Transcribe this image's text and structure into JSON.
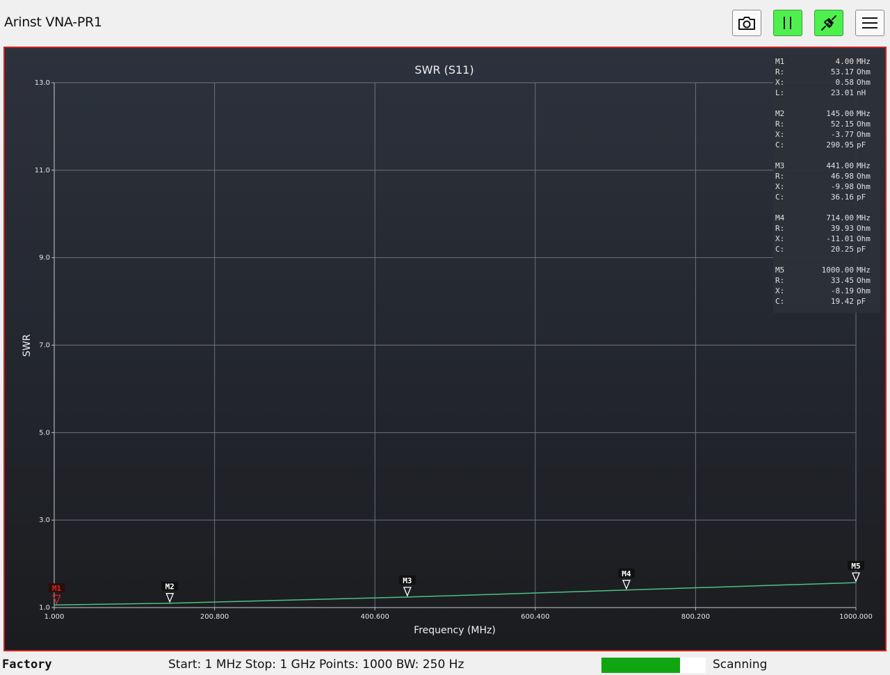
{
  "app": {
    "title": "Arinst VNA-PR1"
  },
  "toolbar": {
    "buttons": [
      {
        "id": "screenshot",
        "icon": "camera-icon"
      },
      {
        "id": "pause",
        "icon": "pause-icon"
      },
      {
        "id": "connect",
        "icon": "plug-connected-icon"
      },
      {
        "id": "menu",
        "icon": "hamburger-menu-icon"
      }
    ]
  },
  "colors": {
    "accent_green": "#4ef04e",
    "frame_red": "#d02020",
    "trace": "#4ec283",
    "active_marker": "#e02020",
    "progress_fill": "#12a512"
  },
  "chart_data": {
    "type": "line",
    "title": "SWR (S11)",
    "xlabel": "Frequency (MHz)",
    "ylabel": "SWR",
    "xlim": [
      1.0,
      1000.0
    ],
    "ylim": [
      1.0,
      13.0
    ],
    "x_ticks": [
      "1.000",
      "200.800",
      "400.600",
      "600.400",
      "800.200",
      "1000.000"
    ],
    "y_ticks": [
      "1.0",
      "3.0",
      "5.0",
      "7.0",
      "9.0",
      "11.0",
      "13.0"
    ],
    "grid": true,
    "series": [
      {
        "x": [
          1,
          145,
          441,
          714,
          1000
        ],
        "y": [
          1.06,
          1.1,
          1.24,
          1.4,
          1.57
        ]
      }
    ],
    "markers": [
      {
        "label": "M1",
        "x": 4,
        "y": 1.06,
        "active": true
      },
      {
        "label": "M2",
        "x": 145,
        "y": 1.1,
        "active": false
      },
      {
        "label": "M3",
        "x": 441,
        "y": 1.24,
        "active": false
      },
      {
        "label": "M4",
        "x": 714,
        "y": 1.4,
        "active": false
      },
      {
        "label": "M5",
        "x": 1000,
        "y": 1.57,
        "active": false
      }
    ],
    "marker_readout": [
      {
        "rows": [
          {
            "k": "M1",
            "v": "4.00",
            "u": "MHz"
          },
          {
            "k": "R:",
            "v": "53.17",
            "u": "Ohm"
          },
          {
            "k": "X:",
            "v": "0.58",
            "u": "Ohm"
          },
          {
            "k": "L:",
            "v": "23.01",
            "u": "nH"
          }
        ]
      },
      {
        "rows": [
          {
            "k": "M2",
            "v": "145.00",
            "u": "MHz"
          },
          {
            "k": "R:",
            "v": "52.15",
            "u": "Ohm"
          },
          {
            "k": "X:",
            "v": "-3.77",
            "u": "Ohm"
          },
          {
            "k": "C:",
            "v": "290.95",
            "u": "pF"
          }
        ]
      },
      {
        "rows": [
          {
            "k": "M3",
            "v": "441.00",
            "u": "MHz"
          },
          {
            "k": "R:",
            "v": "46.98",
            "u": "Ohm"
          },
          {
            "k": "X:",
            "v": "-9.98",
            "u": "Ohm"
          },
          {
            "k": "C:",
            "v": "36.16",
            "u": "pF"
          }
        ]
      },
      {
        "rows": [
          {
            "k": "M4",
            "v": "714.00",
            "u": "MHz"
          },
          {
            "k": "R:",
            "v": "39.93",
            "u": "Ohm"
          },
          {
            "k": "X:",
            "v": "-11.01",
            "u": "Ohm"
          },
          {
            "k": "C:",
            "v": "20.25",
            "u": "pF"
          }
        ]
      },
      {
        "rows": [
          {
            "k": "M5",
            "v": "1000.00",
            "u": "MHz"
          },
          {
            "k": "R:",
            "v": "33.45",
            "u": "Ohm"
          },
          {
            "k": "X:",
            "v": "-8.19",
            "u": "Ohm"
          },
          {
            "k": "C:",
            "v": "19.42",
            "u": "pF"
          }
        ]
      }
    ]
  },
  "status": {
    "profile": "Factory",
    "sweep": "Start: 1 MHz Stop: 1 GHz Points: 1000 BW: 250 Hz",
    "progress": 0.75,
    "state": "Scanning"
  }
}
